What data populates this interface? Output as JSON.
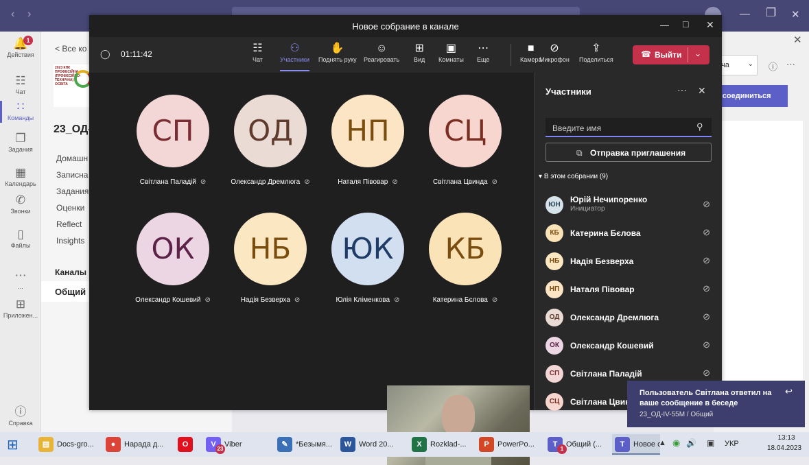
{
  "teams": {
    "rail": [
      {
        "label": "Действия",
        "icon": "bell-icon",
        "badge": "1"
      },
      {
        "label": "Чат",
        "icon": "chat-icon"
      },
      {
        "label": "Команды",
        "icon": "teams-icon",
        "active": true
      },
      {
        "label": "Задания",
        "icon": "assignments-icon"
      },
      {
        "label": "Календарь",
        "icon": "calendar-icon"
      },
      {
        "label": "Звонки",
        "icon": "calls-icon"
      },
      {
        "label": "Файлы",
        "icon": "files-icon"
      },
      {
        "label": "...",
        "icon": "more-icon"
      },
      {
        "label": "Приложен...",
        "icon": "apps-icon"
      },
      {
        "label": "Справка",
        "icon": "help-icon"
      }
    ],
    "channel_pane": {
      "back_link": "< Все ко",
      "logo_text": "2023 КПК ПРОФЕСІЙНА (ПРОФЕСІЙНО-ТЕХНІЧНА) ОСВІТА",
      "team_name": "23_ОД-",
      "menu": [
        "Домашн",
        "Записна",
        "Задания",
        "Оценки",
        "Reflect",
        "Insights"
      ],
      "channels_header": "Каналы",
      "channel": "Общий"
    },
    "right_pane": {
      "dropdown_text": "ча",
      "join_button": "исоединиться"
    }
  },
  "meeting": {
    "title": "Новое собрание в канале",
    "timer": "01:11:42",
    "toolbar": [
      {
        "label": "Чат",
        "icon": "chat-icon"
      },
      {
        "label": "Участники",
        "icon": "people-icon",
        "active": true
      },
      {
        "label": "Поднять руку",
        "icon": "hand-icon"
      },
      {
        "label": "Реагировать",
        "icon": "smile-icon"
      },
      {
        "label": "Вид",
        "icon": "grid-icon"
      },
      {
        "label": "Комнаты",
        "icon": "rooms-icon"
      },
      {
        "label": "Еще",
        "icon": "more-icon"
      },
      {
        "label": "Камера",
        "icon": "camera-icon"
      },
      {
        "label": "Микрофон",
        "icon": "mic-off-icon"
      },
      {
        "label": "Поделиться",
        "icon": "share-icon"
      }
    ],
    "leave_button": "Выйти",
    "tiles": [
      {
        "initials": "СП",
        "name": "Світлана Паладій",
        "bg": "#f3d6d6",
        "fg": "#7a2e34"
      },
      {
        "initials": "ОД",
        "name": "Олександр Дремлюга",
        "bg": "#eadbd5",
        "fg": "#5e3b2c"
      },
      {
        "initials": "НП",
        "name": "Наталя Півовар",
        "bg": "#fbe5c4",
        "fg": "#7a4d0e"
      },
      {
        "initials": "СЦ",
        "name": "Світлана Цвинда",
        "bg": "#f7d6d0",
        "fg": "#7a2e22"
      },
      {
        "initials": "ОК",
        "name": "Олександр Кошевий",
        "bg": "#ecd6e3",
        "fg": "#5c2248"
      },
      {
        "initials": "НБ",
        "name": "Надія Безверха",
        "bg": "#fbe7c2",
        "fg": "#7a4d0e"
      },
      {
        "initials": "ЮК",
        "name": "Юлія Кліменкова",
        "bg": "#d2dff0",
        "fg": "#1f3c66"
      },
      {
        "initials": "КБ",
        "name": "Катерина Бєлова",
        "bg": "#fbe3b8",
        "fg": "#7a4d0e"
      }
    ],
    "participants_panel": {
      "title": "Участники",
      "search_placeholder": "Введите имя",
      "invite_button": "Отправка приглашения",
      "section": "В этом собрании (9)",
      "people": [
        {
          "initials": "ЮН",
          "name": "Юрій Нечипоренко",
          "role": "Инициатор",
          "bg": "#d6e3ea",
          "fg": "#2b4656"
        },
        {
          "initials": "КБ",
          "name": "Катерина Бєлова",
          "bg": "#fbe3b8",
          "fg": "#7a4d0e"
        },
        {
          "initials": "НБ",
          "name": "Надія Безверха",
          "bg": "#fbe7c2",
          "fg": "#7a4d0e"
        },
        {
          "initials": "НП",
          "name": "Наталя Півовар",
          "bg": "#fbe5c4",
          "fg": "#7a4d0e"
        },
        {
          "initials": "ОД",
          "name": "Олександр Дремлюга",
          "bg": "#eadbd5",
          "fg": "#5e3b2c"
        },
        {
          "initials": "ОК",
          "name": "Олександр Кошевий",
          "bg": "#ecd6e3",
          "fg": "#5c2248"
        },
        {
          "initials": "СП",
          "name": "Світлана Паладій",
          "bg": "#f3d6d6",
          "fg": "#7a2e34"
        },
        {
          "initials": "СЦ",
          "name": "Світлана Цвинд",
          "bg": "#f7d6d0",
          "fg": "#7a2e22"
        }
      ]
    }
  },
  "toast": {
    "line1": "Пользователь Світлана ответил на",
    "line2": "ваше сообщение в беседе",
    "line3": "23_ОД-IV-55M / Общий"
  },
  "taskbar": {
    "items": [
      {
        "label": "Docs-gro...",
        "icon": "folder-icon",
        "color": "#e8b437"
      },
      {
        "label": "Нарада д...",
        "icon": "chrome-icon",
        "color": "#db4437"
      },
      {
        "label": "",
        "icon": "opera-icon",
        "color": "#e0101e"
      },
      {
        "label": "Viber",
        "icon": "viber-icon",
        "color": "#7360f2",
        "badge": "23"
      },
      {
        "label": "*Безымя...",
        "icon": "paint-icon",
        "color": "#3b6fb6"
      },
      {
        "label": "Word 20...",
        "icon": "word-icon",
        "color": "#2b579a"
      },
      {
        "label": "Rozklad-...",
        "icon": "excel-icon",
        "color": "#217346"
      },
      {
        "label": "PowerPo...",
        "icon": "powerpoint-icon",
        "color": "#d24726"
      },
      {
        "label": "Общий (...",
        "icon": "teams-icon",
        "color": "#5b5fc7",
        "badge": "1"
      },
      {
        "label": "Новое со...",
        "icon": "teams-icon",
        "color": "#5b5fc7",
        "open": true
      }
    ],
    "lang": "УКР",
    "time": "13:13",
    "date": "18.04.2023"
  }
}
